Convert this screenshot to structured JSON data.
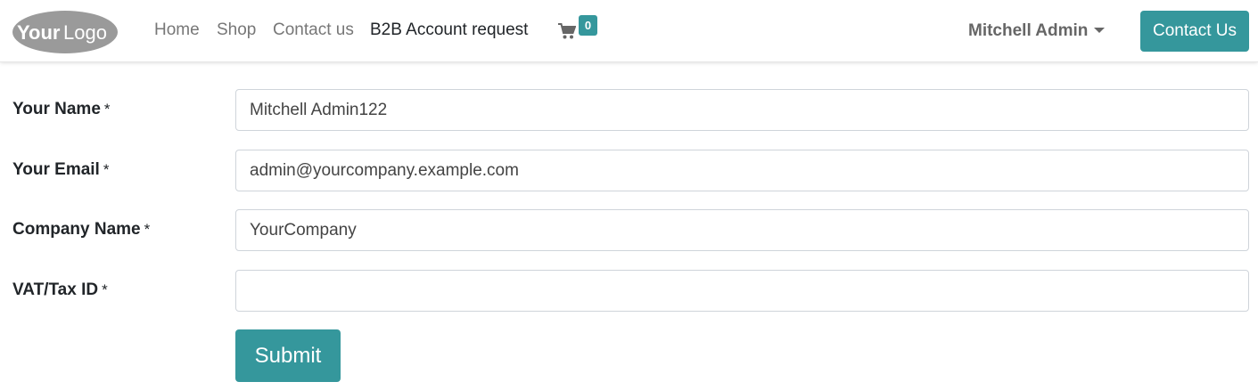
{
  "logo": {
    "text_your": "Your",
    "text_logo": "Logo",
    "icon": "your-logo"
  },
  "nav": {
    "items": [
      {
        "label": "Home"
      },
      {
        "label": "Shop"
      },
      {
        "label": "Contact us"
      },
      {
        "label": "B2B Account request"
      }
    ],
    "active": "B2B Account request"
  },
  "cart": {
    "icon": "shopping-cart-icon",
    "count": "0"
  },
  "user": {
    "name": "Mitchell Admin",
    "icon": "caret-down-icon"
  },
  "header": {
    "contact_label": "Contact Us"
  },
  "form": {
    "required_mark": "*",
    "fields": [
      {
        "label": "Your Name",
        "value": "Mitchell Admin122"
      },
      {
        "label": "Your Email",
        "value": "admin@yourcompany.example.com"
      },
      {
        "label": "Company Name",
        "value": "YourCompany"
      },
      {
        "label": "VAT/Tax ID",
        "value": ""
      }
    ],
    "submit_label": "Submit"
  },
  "colors": {
    "accent": "#35979c",
    "nav_text": "#777777",
    "logo_bg": "#9a9a9a"
  }
}
